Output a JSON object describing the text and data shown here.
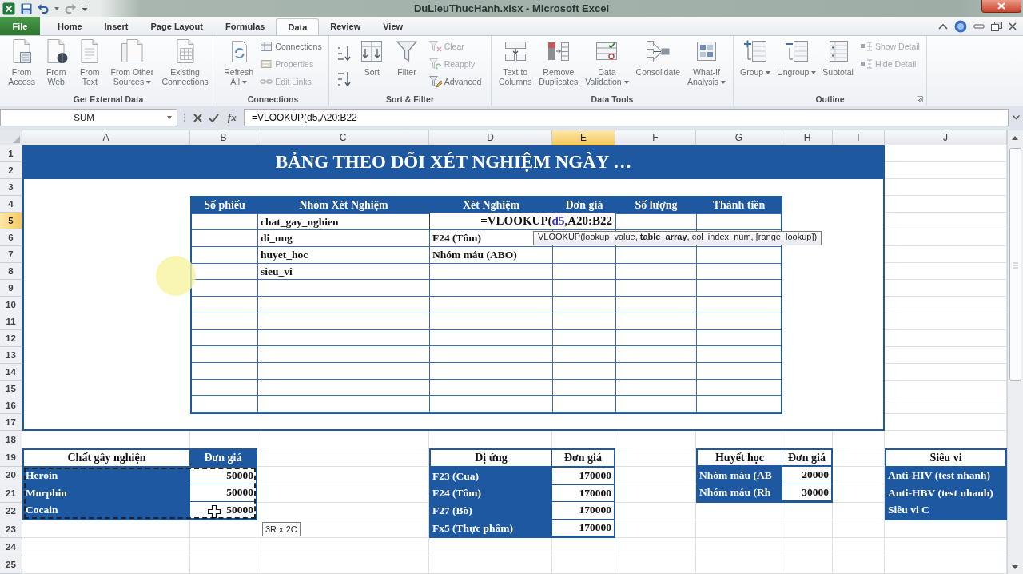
{
  "title_bar": {
    "title": "DuLieuThucHanh.xlsx - Microsoft Excel"
  },
  "tabs": [
    {
      "label": "File",
      "kind": "file",
      "selected": false
    },
    {
      "label": "Home",
      "kind": "tab",
      "selected": false
    },
    {
      "label": "Insert",
      "kind": "tab",
      "selected": false
    },
    {
      "label": "Page Layout",
      "kind": "tab",
      "selected": false
    },
    {
      "label": "Formulas",
      "kind": "tab",
      "selected": false
    },
    {
      "label": "Data",
      "kind": "tab",
      "selected": true
    },
    {
      "label": "Review",
      "kind": "tab",
      "selected": false
    },
    {
      "label": "View",
      "kind": "tab",
      "selected": false
    }
  ],
  "ribbon_groups": [
    {
      "label": "Get External Data",
      "launcher": false,
      "items": [
        {
          "kind": "large",
          "lines": [
            "From",
            "Access"
          ],
          "dropdown": false
        },
        {
          "kind": "large",
          "lines": [
            "From",
            "Web"
          ],
          "dropdown": false
        },
        {
          "kind": "large",
          "lines": [
            "From",
            "Text"
          ],
          "dropdown": false
        },
        {
          "kind": "large",
          "lines": [
            "From Other",
            "Sources"
          ],
          "dropdown": true
        },
        {
          "kind": "large",
          "lines": [
            "Existing",
            "Connections"
          ],
          "dropdown": false
        }
      ]
    },
    {
      "label": "Connections",
      "launcher": false,
      "items": [
        {
          "kind": "large",
          "lines": [
            "Refresh",
            "All"
          ],
          "dropdown": true
        },
        {
          "kind": "small",
          "lines": [
            "Connections"
          ],
          "disabled": false
        },
        {
          "kind": "small",
          "lines": [
            "Properties"
          ],
          "disabled": true
        },
        {
          "kind": "small",
          "lines": [
            "Edit Links"
          ],
          "disabled": true
        }
      ]
    },
    {
      "label": "Sort & Filter",
      "launcher": false,
      "items": [
        {
          "kind": "icon"
        },
        {
          "kind": "icon"
        },
        {
          "kind": "large",
          "lines": [
            "Sort"
          ],
          "dropdown": false
        },
        {
          "kind": "large",
          "lines": [
            "Filter"
          ],
          "dropdown": false
        },
        {
          "kind": "small",
          "lines": [
            "Clear"
          ],
          "disabled": true
        },
        {
          "kind": "small",
          "lines": [
            "Reapply"
          ],
          "disabled": true
        },
        {
          "kind": "small",
          "lines": [
            "Advanced"
          ],
          "disabled": false
        }
      ]
    },
    {
      "label": "Data Tools",
      "launcher": false,
      "items": [
        {
          "kind": "large",
          "lines": [
            "Text to",
            "Columns"
          ],
          "dropdown": false
        },
        {
          "kind": "large",
          "lines": [
            "Remove",
            "Duplicates"
          ],
          "dropdown": false
        },
        {
          "kind": "large",
          "lines": [
            "Data",
            "Validation"
          ],
          "dropdown": true
        },
        {
          "kind": "large",
          "lines": [
            "Consolidate"
          ],
          "dropdown": false
        },
        {
          "kind": "large",
          "lines": [
            "What-If",
            "Analysis"
          ],
          "dropdown": true
        }
      ]
    },
    {
      "label": "Outline",
      "launcher": true,
      "items": [
        {
          "kind": "large",
          "lines": [
            "Group"
          ],
          "dropdown": true
        },
        {
          "kind": "large",
          "lines": [
            "Ungroup"
          ],
          "dropdown": true
        },
        {
          "kind": "large",
          "lines": [
            "Subtotal"
          ],
          "dropdown": false
        },
        {
          "kind": "small",
          "lines": [
            "Show Detail"
          ],
          "disabled": true
        },
        {
          "kind": "small",
          "lines": [
            "Hide Detail"
          ],
          "disabled": true
        }
      ]
    }
  ],
  "formula_bar": {
    "name_box": "SUM",
    "function_label": "fx",
    "formula": "=VLOOKUP(d5,A20:B22"
  },
  "column_headers": [
    {
      "label": "A",
      "selected": false
    },
    {
      "label": "B",
      "selected": false
    },
    {
      "label": "C",
      "selected": false
    },
    {
      "label": "D",
      "selected": false
    },
    {
      "label": "E",
      "selected": true
    },
    {
      "label": "F",
      "selected": false
    },
    {
      "label": "G",
      "selected": false
    },
    {
      "label": "H",
      "selected": false
    },
    {
      "label": "I",
      "selected": false
    },
    {
      "label": "J",
      "selected": false
    }
  ],
  "row_headers": [
    {
      "label": "1",
      "selected": false
    },
    {
      "label": "2",
      "selected": false
    },
    {
      "label": "3",
      "selected": false
    },
    {
      "label": "4",
      "selected": false
    },
    {
      "label": "5",
      "selected": true
    },
    {
      "label": "6",
      "selected": false
    },
    {
      "label": "7",
      "selected": false
    },
    {
      "label": "8",
      "selected": false
    },
    {
      "label": "9",
      "selected": false
    },
    {
      "label": "10",
      "selected": false
    },
    {
      "label": "11",
      "selected": false
    },
    {
      "label": "12",
      "selected": false
    },
    {
      "label": "13",
      "selected": false
    },
    {
      "label": "14",
      "selected": false
    },
    {
      "label": "15",
      "selected": false
    },
    {
      "label": "16",
      "selected": false
    },
    {
      "label": "17",
      "selected": false
    },
    {
      "label": "18",
      "selected": false
    },
    {
      "label": "19",
      "selected": false
    },
    {
      "label": "20",
      "selected": false
    },
    {
      "label": "21",
      "selected": false
    },
    {
      "label": "22",
      "selected": false
    },
    {
      "label": "23",
      "selected": false
    },
    {
      "label": "24",
      "selected": false
    },
    {
      "label": "25",
      "selected": false
    }
  ],
  "banner": {
    "title": "BẢNG THEO DÕI XÉT NGHIỆM NGÀY …"
  },
  "main_table": {
    "columns": [
      "Số phiếu",
      "Nhóm Xét Nghiệm",
      "Xét Nghiệm",
      "Đơn giá",
      "Số lượng",
      "Thành tiền"
    ],
    "rows": [
      {
        "group": "chat_gay_nghien"
      },
      {
        "group": "di_ung",
        "test": "F24 (Tôm)"
      },
      {
        "group": "huyet_hoc",
        "test": "Nhóm máu (ABO)"
      },
      {
        "group": "sieu_vi"
      },
      {},
      {},
      {},
      {},
      {},
      {},
      {},
      {}
    ]
  },
  "cell_editor": {
    "parts": [
      {
        "kind": "text",
        "text": "=VLOOKUP("
      },
      {
        "kind": "reference",
        "text": "d5"
      },
      {
        "kind": "text",
        "text": ",A20:B22"
      }
    ]
  },
  "function_tooltip": "VLOOKUP(lookup_value, **table_array**, col_index_num, [range_lookup])",
  "lookup_tables": [
    {
      "referenced": true,
      "headers": [
        {
          "label": "Chất gây nghiện",
          "shaded": false
        },
        {
          "label": "Đơn giá",
          "shaded": true
        }
      ],
      "rows": [
        {
          "name": "Heroin",
          "price": "50000"
        },
        {
          "name": "Morphin",
          "price": "50000"
        },
        {
          "name": "Cocain",
          "price": "50000"
        }
      ]
    },
    {
      "referenced": false,
      "headers": [
        {
          "label": "Dị ứng",
          "shaded": false
        },
        {
          "label": "Đơn giá",
          "shaded": false
        }
      ],
      "rows": [
        {
          "name": "F23 (Cua)",
          "price": "170000"
        },
        {
          "name": "F24 (Tôm)",
          "price": "170000"
        },
        {
          "name": "F27 (Bò)",
          "price": "170000"
        },
        {
          "name": "Fx5 (Thực phẩm)",
          "price": "170000"
        }
      ]
    },
    {
      "referenced": false,
      "headers": [
        {
          "label": "Huyết học",
          "shaded": false
        },
        {
          "label": "Đơn giá",
          "shaded": false
        }
      ],
      "rows": [
        {
          "name": "Nhóm máu (AB",
          "price": "20000"
        },
        {
          "name": "Nhóm máu (Rh",
          "price": "30000"
        }
      ]
    },
    {
      "referenced": false,
      "headers": [
        {
          "label": "Siêu vi",
          "shaded": false
        }
      ],
      "rows": [
        {
          "name": "Anti-HIV (test nhanh)"
        },
        {
          "name": "Anti-HBV (test nhanh)"
        },
        {
          "name": "Siêu vi C"
        }
      ]
    }
  ],
  "selection_size_tip": "3R x 2C"
}
